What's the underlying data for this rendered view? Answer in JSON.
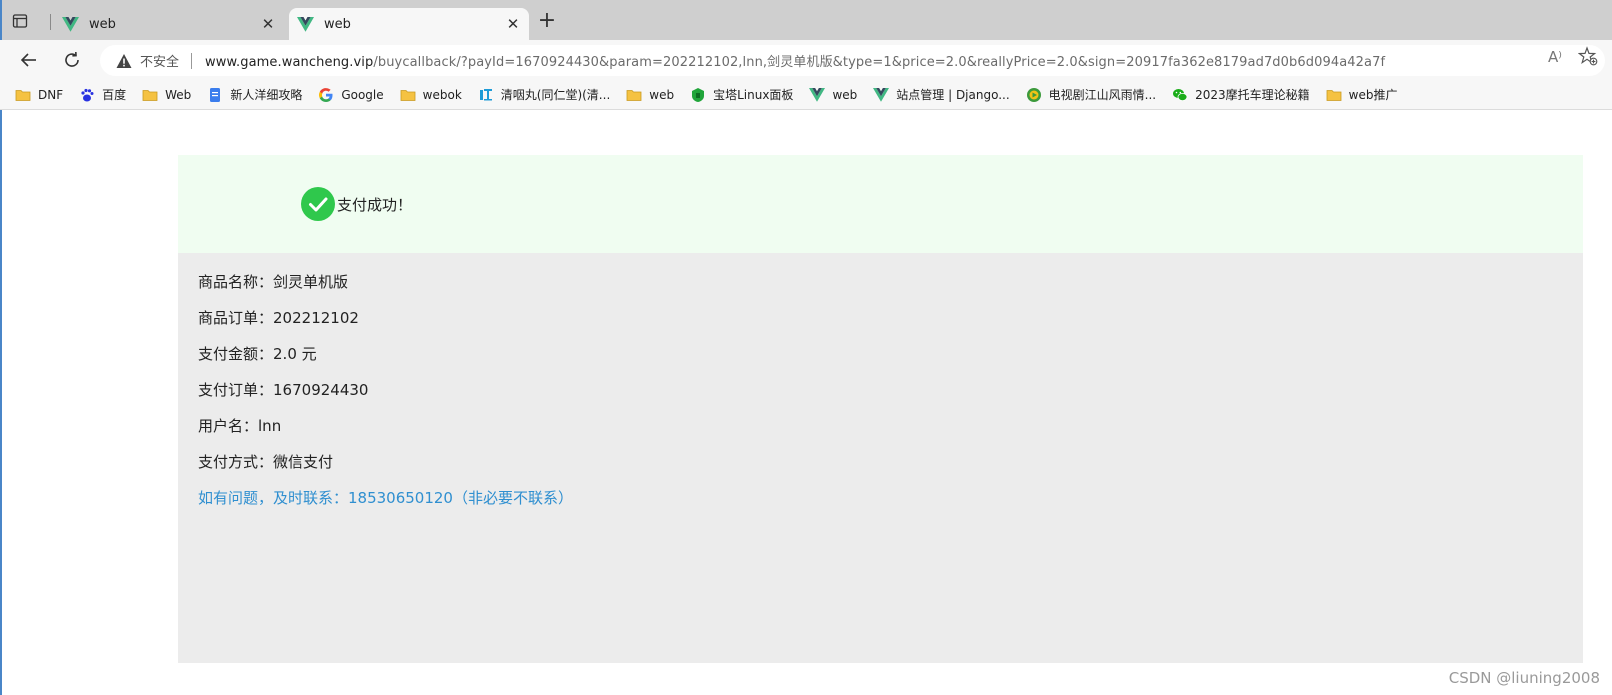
{
  "browser": {
    "tabs": [
      {
        "title": "web",
        "icon": "vue-logo-icon"
      },
      {
        "title": "web",
        "icon": "vue-logo-icon"
      }
    ],
    "close_symbol": "✕",
    "new_tab_symbol": "+",
    "security_label": "不安全",
    "url_host": "www.game.wancheng.vip",
    "url_path": "/buycallback/?payId=1670924430&param=202212102,lnn,剑灵单机版&type=1&price=2.0&reallyPrice=2.0&sign=20917fa362e8179ad7d0b6d094a42a7f",
    "read_aloud_glyph": "A⁾"
  },
  "bookmarks": [
    {
      "label": "DNF",
      "icon": "folder-icon"
    },
    {
      "label": "百度",
      "icon": "baidu-paw-icon"
    },
    {
      "label": "Web",
      "icon": "folder-icon"
    },
    {
      "label": "新人洋细攻略",
      "icon": "doc-icon"
    },
    {
      "label": "Google",
      "icon": "google-icon"
    },
    {
      "label": "webok",
      "icon": "folder-icon"
    },
    {
      "label": "清咽丸(同仁堂)(清...",
      "icon": "jd-health-icon"
    },
    {
      "label": "web",
      "icon": "folder-icon"
    },
    {
      "label": "宝塔Linux面板",
      "icon": "baota-icon"
    },
    {
      "label": "web",
      "icon": "vue-logo-icon"
    },
    {
      "label": "站点管理 | Django...",
      "icon": "vue-logo-icon"
    },
    {
      "label": "电视剧江山风雨情...",
      "icon": "tv-icon"
    },
    {
      "label": "2023摩托车理论秘籍",
      "icon": "wechat-icon"
    },
    {
      "label": "web推广",
      "icon": "folder-icon"
    }
  ],
  "page": {
    "success_message": "支付成功！",
    "details": [
      {
        "label": "商品名称：",
        "value": "剑灵单机版"
      },
      {
        "label": "商品订单：",
        "value": "202212102"
      },
      {
        "label": "支付金额：",
        "value": "2.0 元"
      },
      {
        "label": "支付订单：",
        "value": "1670924430"
      },
      {
        "label": "用户名：",
        "value": "lnn"
      },
      {
        "label": "支付方式：",
        "value": "微信支付"
      }
    ],
    "contact_note": "如有问题，及时联系：18530650120（非必要不联系）",
    "watermark": "CSDN @liuning2008"
  },
  "colors": {
    "success_green": "#2fc84c",
    "contact_blue": "#2f8fd0",
    "banner_bg": "#f0fdf1",
    "panel_bg": "#ececec"
  }
}
